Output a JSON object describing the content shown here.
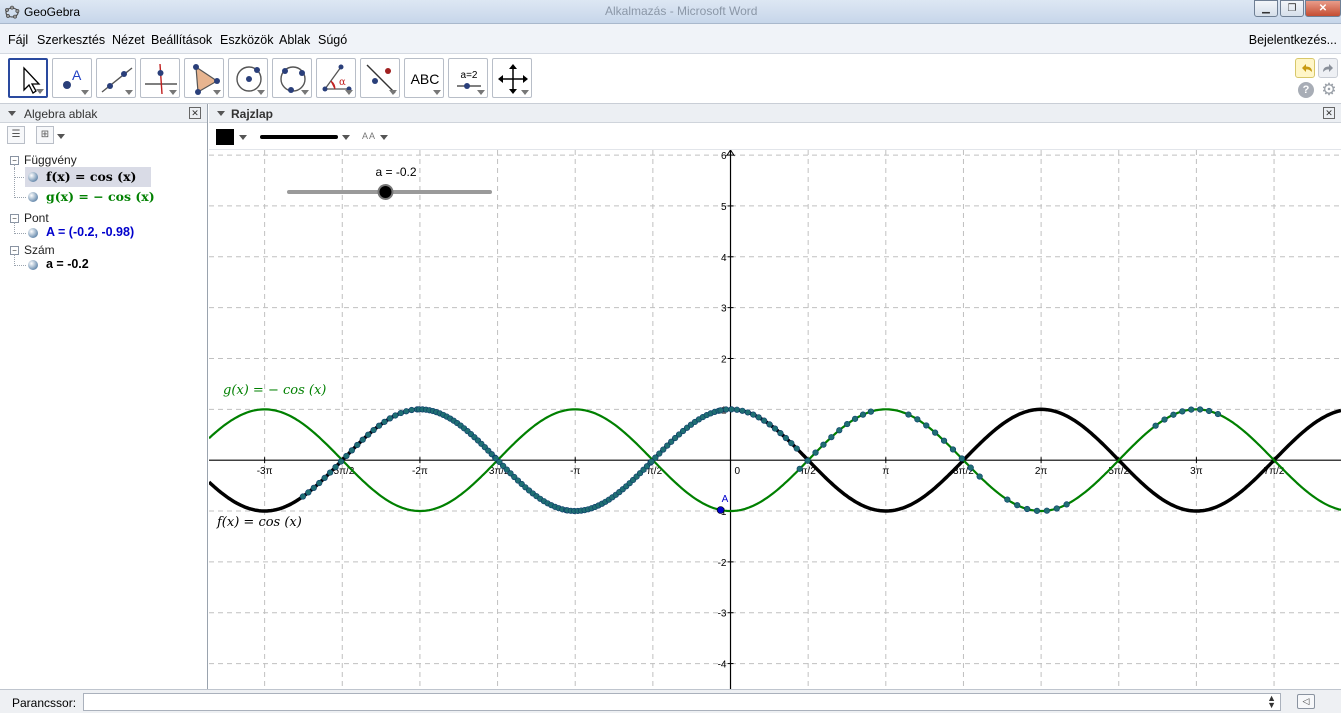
{
  "window": {
    "title": "GeoGebra",
    "background_title": "Alkalmazás - Microsoft Word"
  },
  "menu": {
    "items": [
      "Fájl",
      "Szerkesztés",
      "Nézet",
      "Beállítások",
      "Eszközök",
      "Ablak",
      "Súgó"
    ],
    "login": "Bejelentkezés..."
  },
  "toolbar": {
    "tools": [
      {
        "icon": "move-arrow-icon",
        "selected": true
      },
      {
        "icon": "point-icon"
      },
      {
        "icon": "line-icon"
      },
      {
        "icon": "perpendicular-line-icon"
      },
      {
        "icon": "polygon-icon"
      },
      {
        "icon": "circle-center-point-icon"
      },
      {
        "icon": "circle-three-points-icon"
      },
      {
        "icon": "angle-icon"
      },
      {
        "icon": "reflect-icon"
      },
      {
        "icon": "text-tool-icon",
        "text": "ABC"
      },
      {
        "icon": "slider-tool-icon",
        "text": "a=2"
      },
      {
        "icon": "move-view-icon"
      }
    ]
  },
  "algebra": {
    "title": "Algebra ablak",
    "groups": [
      {
        "name": "Függvény",
        "items": [
          {
            "text": "f(x) = cos (x)",
            "color": "#000000",
            "selected": true
          },
          {
            "text": "g(x) = − cos (x)",
            "color": "#008000"
          }
        ]
      },
      {
        "name": "Pont",
        "items": [
          {
            "text": "A = (-0.2, -0.98)",
            "color": "#0000cc"
          }
        ]
      },
      {
        "name": "Szám",
        "items": [
          {
            "text": "a = -0.2",
            "color": "#000000"
          }
        ]
      }
    ]
  },
  "graphics": {
    "title": "Rajzlap",
    "slider_label": "a = -0.2",
    "slider_value": -0.2,
    "slider_range": [
      -5,
      5
    ],
    "g_label": "g(x)  =  − cos (x)",
    "f_label": "f(x)  =  cos (x)",
    "point_label": "A",
    "point": {
      "x": -0.2,
      "y": -0.98
    },
    "origin_label": "0",
    "x_tick_labels": [
      "-3π",
      "-5π/2",
      "-2π",
      "-3π/2",
      "-π",
      "-π/2",
      "π/2",
      "π",
      "3π/2",
      "2π",
      "5π/2",
      "3π",
      "7π/2"
    ],
    "y_tick_labels": [
      "6",
      "5",
      "4",
      "3",
      "2",
      "1",
      "-1",
      "-2",
      "-3",
      "-4"
    ],
    "colors": {
      "f": "#000000",
      "g": "#008000",
      "trace": "#1f6f73",
      "point": "#0000cc"
    }
  },
  "chart_data": {
    "type": "line",
    "xlim": [
      -10.55,
      12.35
    ],
    "ylim": [
      -4.5,
      6.1
    ],
    "grid": true,
    "series": [
      {
        "name": "f(x) = cos (x)",
        "expression": "cos(x)",
        "color": "#000000"
      },
      {
        "name": "g(x) = − cos (x)",
        "expression": "-cos(x)",
        "color": "#008000"
      }
    ]
  },
  "inputbar": {
    "label": "Parancssor:",
    "value": ""
  }
}
